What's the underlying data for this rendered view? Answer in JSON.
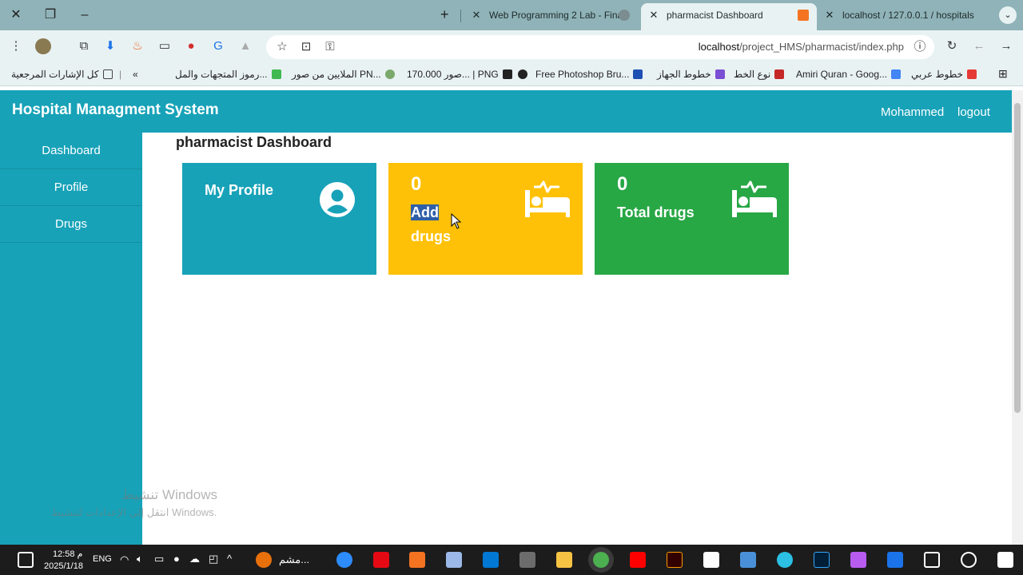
{
  "browser": {
    "tabs": [
      {
        "title": "Web Programming 2 Lab - Fina",
        "active": false
      },
      {
        "title": "pharmacist Dashboard",
        "active": true
      },
      {
        "title": "localhost / 127.0.0.1 / hospitals",
        "active": false
      }
    ],
    "url_host": "localhost",
    "url_path": "/project_HMS/pharmacist/index.php",
    "bookmarks": [
      "كل الإشارات المرجعية",
      "رموز المتجهات والمل...",
      "الملايين من صور PN...",
      "صور 170.000... | PNG",
      "Free Photoshop Bru...",
      "خطوط الجهاز",
      "نوع الخط",
      "Amiri Quran - Goog...",
      "خطوط عربي"
    ]
  },
  "app": {
    "brand": "Hospital Managment System",
    "user": "Mohammed",
    "logout": "logout",
    "sidebar": [
      "Dashboard",
      "Profile",
      "Drugs"
    ],
    "page_title": "pharmacist Dashboard",
    "cards": {
      "profile": {
        "label": "My Profile",
        "color": "#17a2b8",
        "icon": "user-circle-icon"
      },
      "add_drugs": {
        "count": "0",
        "label_highlight": "Add",
        "label_rest": "drugs",
        "color": "#ffc107",
        "icon": "bed-pulse-icon"
      },
      "total_drugs": {
        "count": "0",
        "label": "Total drugs",
        "color": "#28a745",
        "icon": "bed-pulse-icon"
      }
    }
  },
  "os": {
    "watermark_title": "تنشيط Windows",
    "watermark_sub": "انتقل إلى الإعدادات لتنشيط Windows.",
    "time": "12:58 م",
    "date": "2025/1/18",
    "lang": "ENG",
    "taskbar_item": "مشم..."
  }
}
